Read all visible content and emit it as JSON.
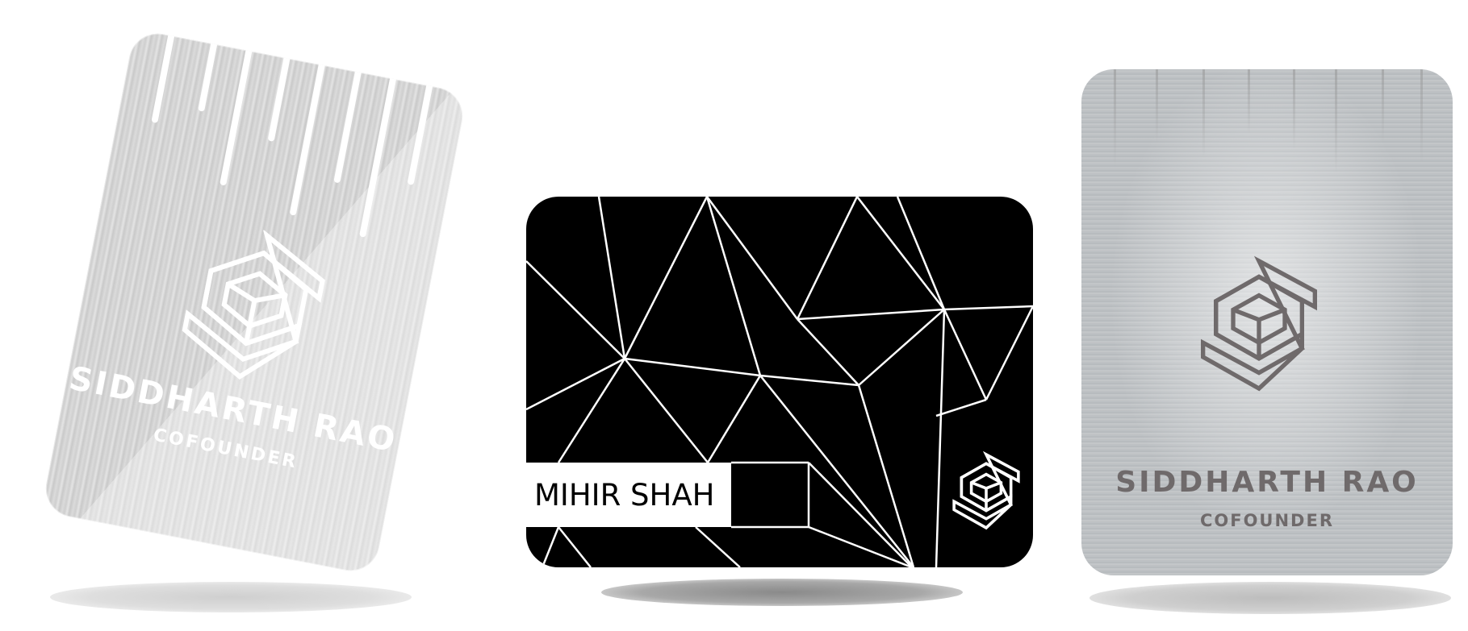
{
  "cards": [
    {
      "style": "tilted-silver",
      "name": "SIDDHARTH RAO",
      "role": "COFOUNDER",
      "text_color": "#ffffff",
      "logo_icon": "hexagon-s-logo-icon"
    },
    {
      "style": "black-geometric",
      "name": "MIHIR SHAH",
      "text_color": "#000000",
      "logo_icon": "hexagon-s-logo-icon"
    },
    {
      "style": "brushed-steel",
      "name": "SIDDHARTH RAO",
      "role": "COFOUNDER",
      "text_color": "#6f6a6b",
      "logo_icon": "hexagon-s-logo-icon"
    }
  ]
}
